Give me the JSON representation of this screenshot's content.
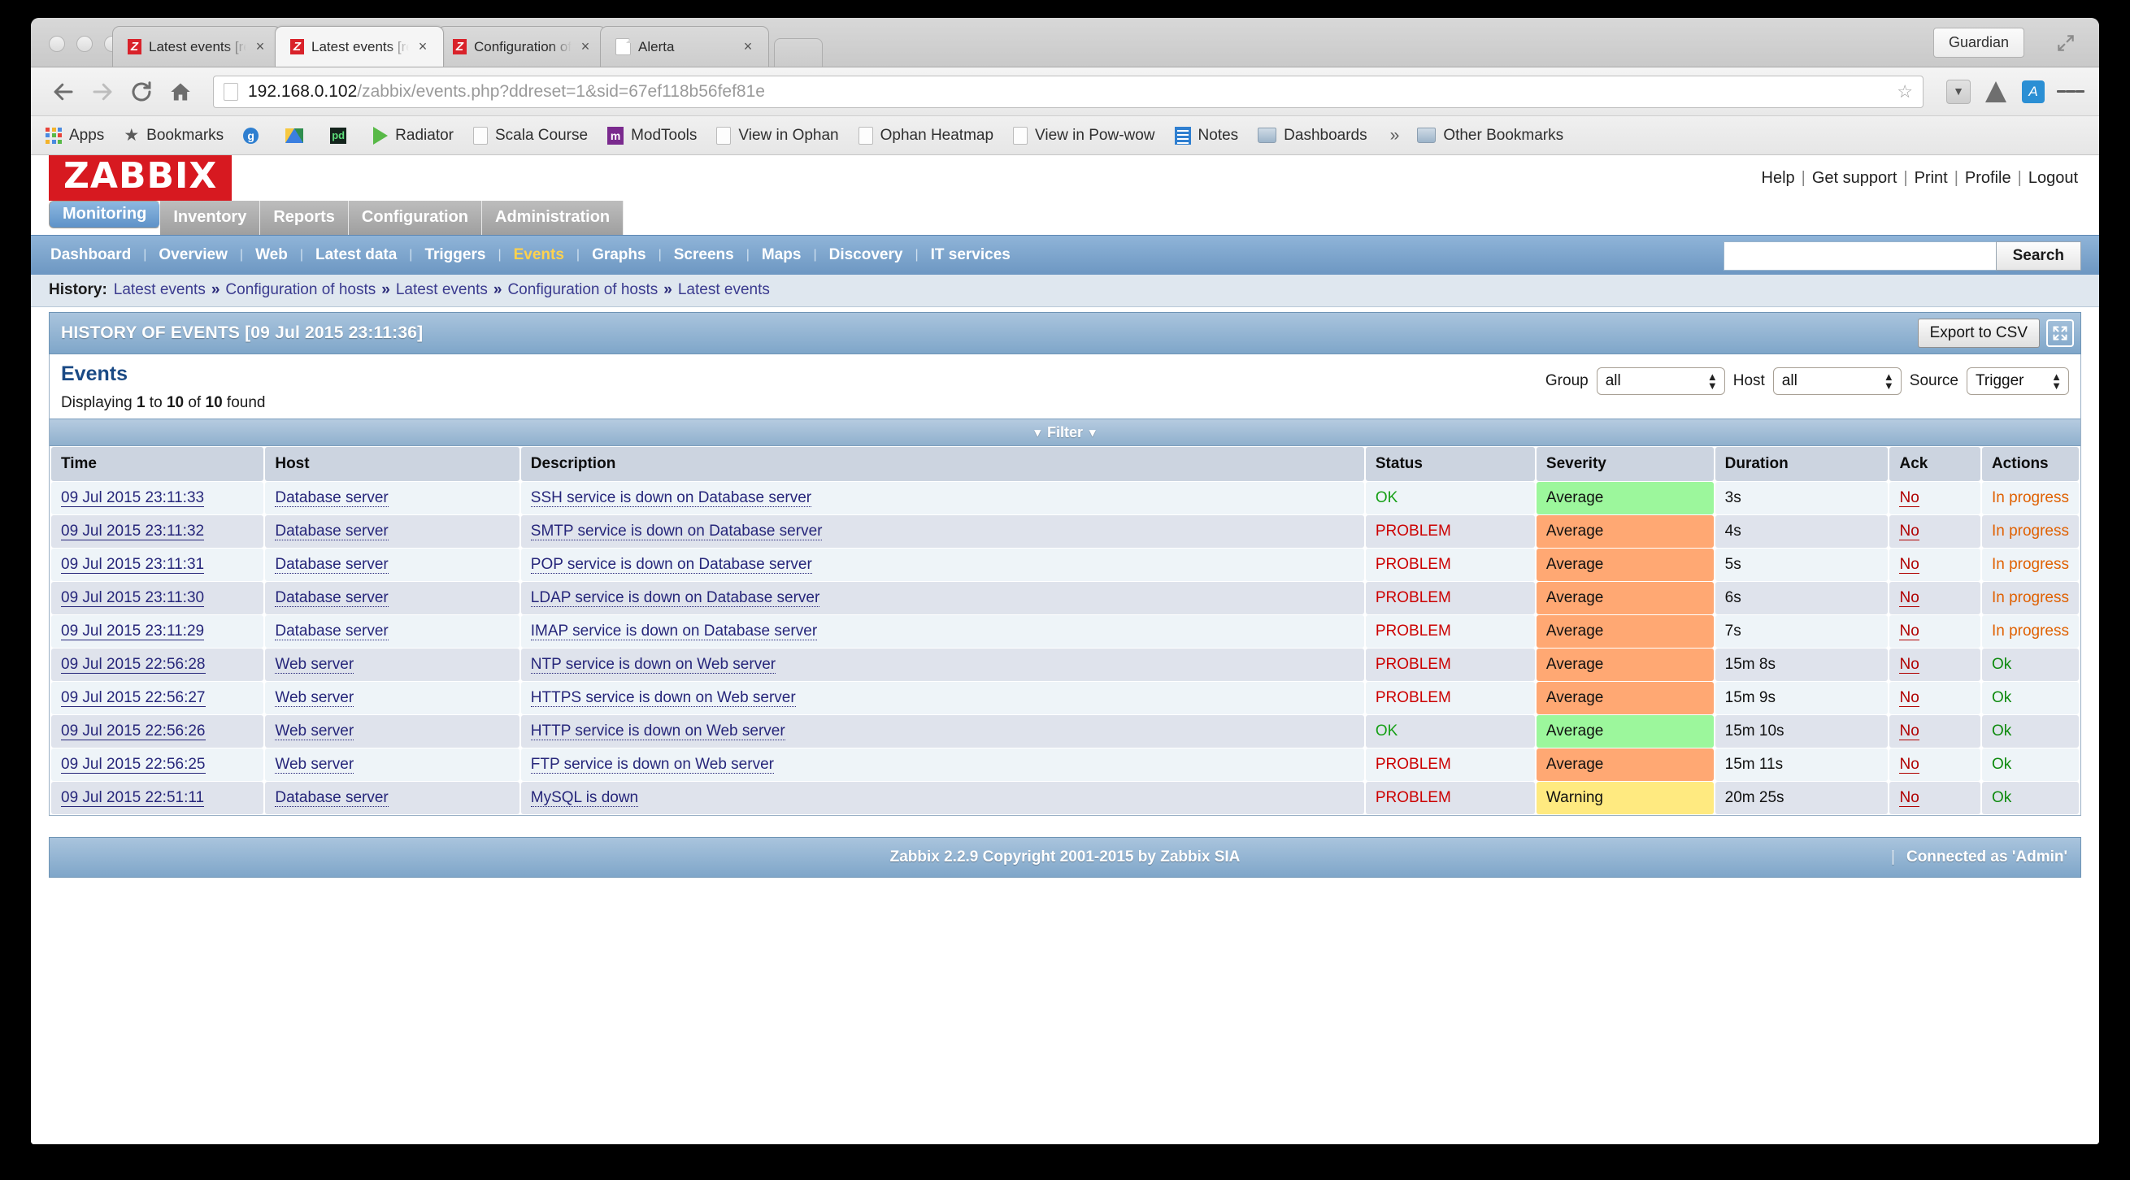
{
  "browser": {
    "tabs": [
      {
        "title": "Latest events [refreshed ev",
        "favicon": "zabbix-icon",
        "close": "×",
        "active": false
      },
      {
        "title": "Latest events [refreshed ev",
        "favicon": "zabbix-icon",
        "close": "×",
        "active": true
      },
      {
        "title": "Configuration of hosts",
        "favicon": "zabbix-icon",
        "close": "×",
        "active": false
      },
      {
        "title": "Alerta",
        "favicon": "page-icon",
        "close": "×",
        "active": false
      }
    ],
    "profile_label": "Guardian",
    "url": {
      "host": "192.168.0.102",
      "path": "/zabbix/events.php?ddreset=1&sid=67ef118b56fef81e"
    },
    "bookmarks": [
      {
        "label": "Apps",
        "icon": "apps-grid-icon"
      },
      {
        "label": "Bookmarks",
        "icon": "star-icon"
      },
      {
        "label": "",
        "icon": "g-circle-icon"
      },
      {
        "label": "",
        "icon": "google-drive-icon"
      },
      {
        "label": "",
        "icon": "pd-icon"
      },
      {
        "label": "Radiator",
        "icon": "play-triangle-icon"
      },
      {
        "label": "Scala Course",
        "icon": "page-icon"
      },
      {
        "label": "ModTools",
        "icon": "modtools-icon"
      },
      {
        "label": "View in Ophan",
        "icon": "page-icon"
      },
      {
        "label": "Ophan Heatmap",
        "icon": "page-icon"
      },
      {
        "label": "View in Pow-wow",
        "icon": "page-icon"
      },
      {
        "label": "Notes",
        "icon": "notes-icon"
      },
      {
        "label": "Dashboards",
        "icon": "folder-icon"
      }
    ],
    "bookmarks_overflow": "»",
    "other_bookmarks": {
      "label": "Other Bookmarks",
      "icon": "folder-icon"
    }
  },
  "zabbix": {
    "logo": "ZABBIX",
    "top_links": [
      "Help",
      "Get support",
      "Print",
      "Profile",
      "Logout"
    ],
    "main_menu": [
      {
        "label": "Monitoring",
        "selected": true
      },
      {
        "label": "Inventory",
        "selected": false
      },
      {
        "label": "Reports",
        "selected": false
      },
      {
        "label": "Configuration",
        "selected": false
      },
      {
        "label": "Administration",
        "selected": false
      }
    ],
    "sub_menu": [
      {
        "label": "Dashboard",
        "current": false
      },
      {
        "label": "Overview",
        "current": false
      },
      {
        "label": "Web",
        "current": false
      },
      {
        "label": "Latest data",
        "current": false
      },
      {
        "label": "Triggers",
        "current": false
      },
      {
        "label": "Events",
        "current": true
      },
      {
        "label": "Graphs",
        "current": false
      },
      {
        "label": "Screens",
        "current": false
      },
      {
        "label": "Maps",
        "current": false
      },
      {
        "label": "Discovery",
        "current": false
      },
      {
        "label": "IT services",
        "current": false
      }
    ],
    "search": {
      "value": "",
      "button_label": "Search"
    },
    "history": {
      "label": "History:",
      "items": [
        "Latest events",
        "Configuration of hosts",
        "Latest events",
        "Configuration of hosts",
        "Latest events"
      ],
      "separator": "»"
    },
    "page_title": "HISTORY OF EVENTS [09 Jul 2015 23:11:36]",
    "export_button": "Export to CSV",
    "fullscreen_icon": "fullscreen-icon",
    "section_title": "Events",
    "displaying": {
      "prefix": "Displaying",
      "from": "1",
      "mid": "to",
      "to": "10",
      "of": "of",
      "total": "10",
      "suffix": "found"
    },
    "filters": [
      {
        "name": "Group",
        "value": "all"
      },
      {
        "name": "Host",
        "value": "all"
      },
      {
        "name": "Source",
        "value": "Trigger"
      }
    ],
    "filter_bar": {
      "label": "Filter",
      "chevron": "⌄"
    },
    "table": {
      "columns": [
        "Time",
        "Host",
        "Description",
        "Status",
        "Severity",
        "Duration",
        "Ack",
        "Actions"
      ],
      "rows": [
        {
          "time": "09 Jul 2015 23:11:33",
          "host": "Database server",
          "description": "SSH service is down on Database server",
          "status": "OK",
          "severity": "Average",
          "severity_color": "#9cf79c",
          "duration": "3s",
          "ack": "No",
          "actions": "In progress",
          "action_state": "progress"
        },
        {
          "time": "09 Jul 2015 23:11:32",
          "host": "Database server",
          "description": "SMTP service is down on Database server",
          "status": "PROBLEM",
          "severity": "Average",
          "severity_color": "#ffa873",
          "duration": "4s",
          "ack": "No",
          "actions": "In progress",
          "action_state": "progress"
        },
        {
          "time": "09 Jul 2015 23:11:31",
          "host": "Database server",
          "description": "POP service is down on Database server",
          "status": "PROBLEM",
          "severity": "Average",
          "severity_color": "#ffa873",
          "duration": "5s",
          "ack": "No",
          "actions": "In progress",
          "action_state": "progress"
        },
        {
          "time": "09 Jul 2015 23:11:30",
          "host": "Database server",
          "description": "LDAP service is down on Database server",
          "status": "PROBLEM",
          "severity": "Average",
          "severity_color": "#ffa873",
          "duration": "6s",
          "ack": "No",
          "actions": "In progress",
          "action_state": "progress"
        },
        {
          "time": "09 Jul 2015 23:11:29",
          "host": "Database server",
          "description": "IMAP service is down on Database server",
          "status": "PROBLEM",
          "severity": "Average",
          "severity_color": "#ffa873",
          "duration": "7s",
          "ack": "No",
          "actions": "In progress",
          "action_state": "progress"
        },
        {
          "time": "09 Jul 2015 22:56:28",
          "host": "Web server",
          "description": "NTP service is down on Web server",
          "status": "PROBLEM",
          "severity": "Average",
          "severity_color": "#ffa873",
          "duration": "15m 8s",
          "ack": "No",
          "actions": "Ok",
          "action_state": "ok"
        },
        {
          "time": "09 Jul 2015 22:56:27",
          "host": "Web server",
          "description": "HTTPS service is down on Web server",
          "status": "PROBLEM",
          "severity": "Average",
          "severity_color": "#ffa873",
          "duration": "15m 9s",
          "ack": "No",
          "actions": "Ok",
          "action_state": "ok"
        },
        {
          "time": "09 Jul 2015 22:56:26",
          "host": "Web server",
          "description": "HTTP service is down on Web server",
          "status": "OK",
          "severity": "Average",
          "severity_color": "#9cf79c",
          "duration": "15m 10s",
          "ack": "No",
          "actions": "Ok",
          "action_state": "ok"
        },
        {
          "time": "09 Jul 2015 22:56:25",
          "host": "Web server",
          "description": "FTP service is down on Web server",
          "status": "PROBLEM",
          "severity": "Average",
          "severity_color": "#ffa873",
          "duration": "15m 11s",
          "ack": "No",
          "actions": "Ok",
          "action_state": "ok"
        },
        {
          "time": "09 Jul 2015 22:51:11",
          "host": "Database server",
          "description": "MySQL is down",
          "status": "PROBLEM",
          "severity": "Warning",
          "severity_color": "#ffea80",
          "duration": "20m 25s",
          "ack": "No",
          "actions": "Ok",
          "action_state": "ok"
        }
      ]
    },
    "footer": {
      "copyright": "Zabbix 2.2.9 Copyright 2001-2015 by Zabbix SIA",
      "separator": "|",
      "connected": "Connected as 'Admin'"
    }
  }
}
